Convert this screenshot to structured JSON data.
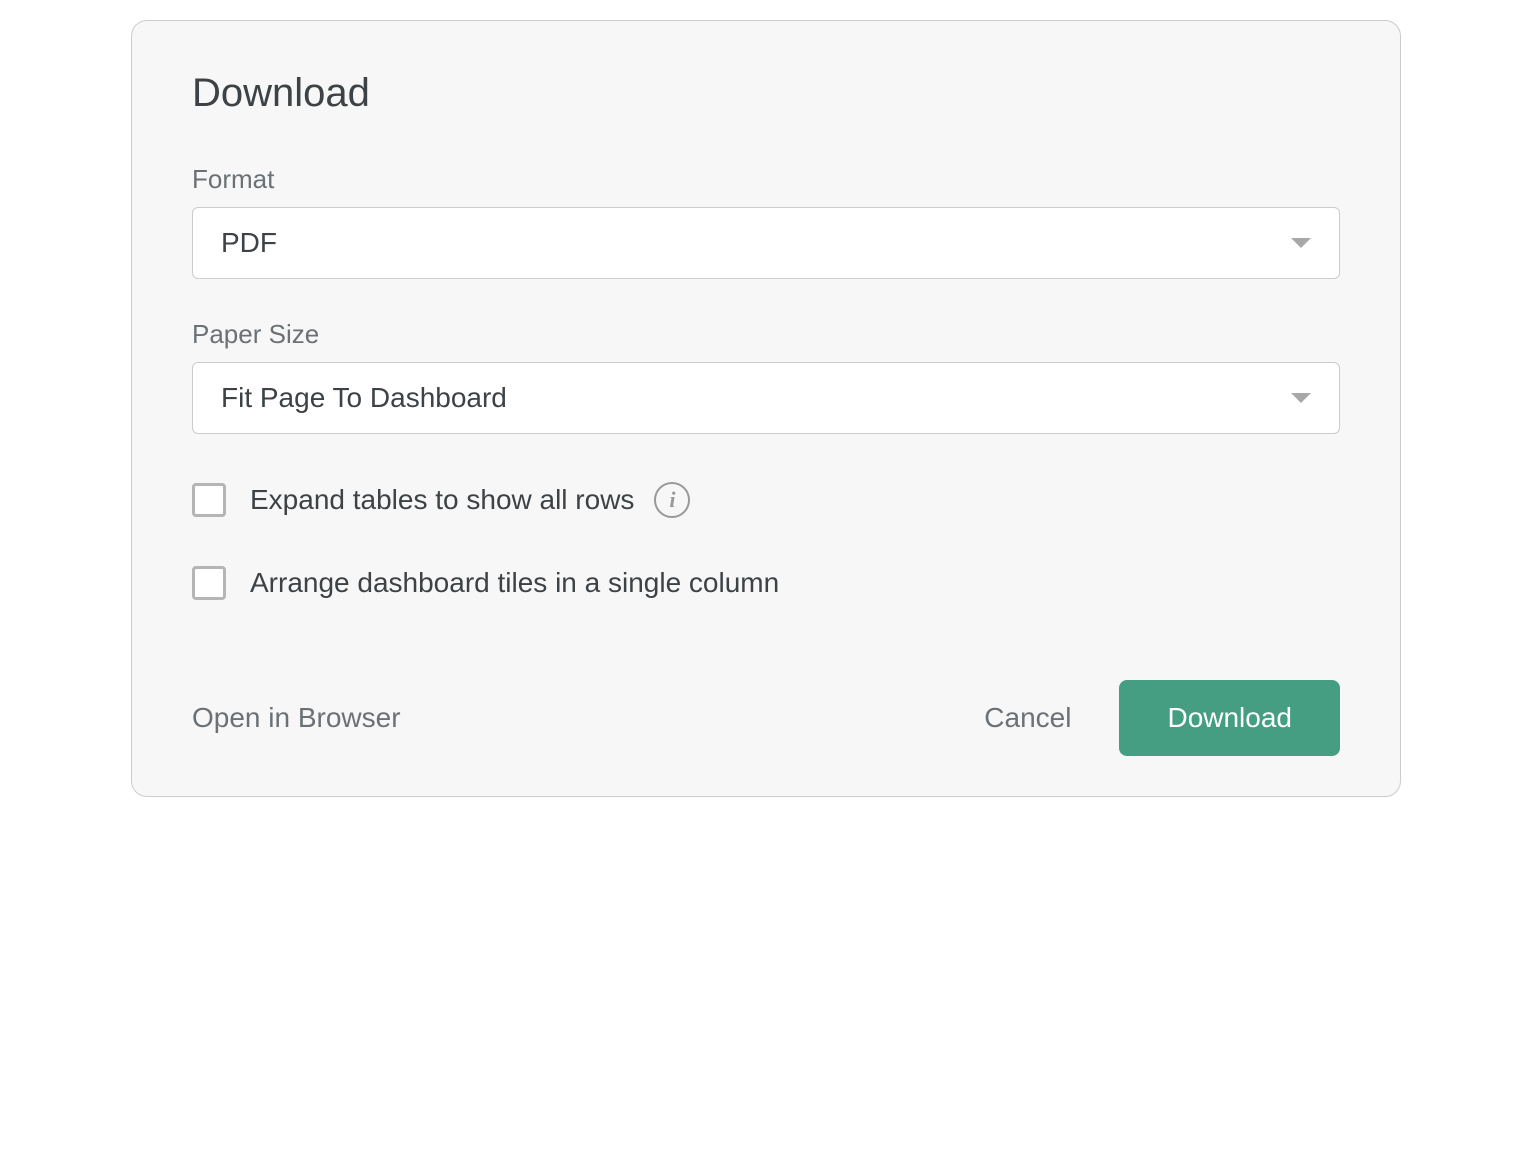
{
  "dialog": {
    "title": "Download",
    "fields": {
      "format": {
        "label": "Format",
        "value": "PDF"
      },
      "paperSize": {
        "label": "Paper Size",
        "value": "Fit Page To Dashboard"
      }
    },
    "checkboxes": {
      "expandTables": {
        "label": "Expand tables to show all rows",
        "checked": false
      },
      "arrangeTiles": {
        "label": "Arrange dashboard tiles in a single column",
        "checked": false
      }
    },
    "footer": {
      "openInBrowser": "Open in Browser",
      "cancel": "Cancel",
      "download": "Download"
    }
  }
}
